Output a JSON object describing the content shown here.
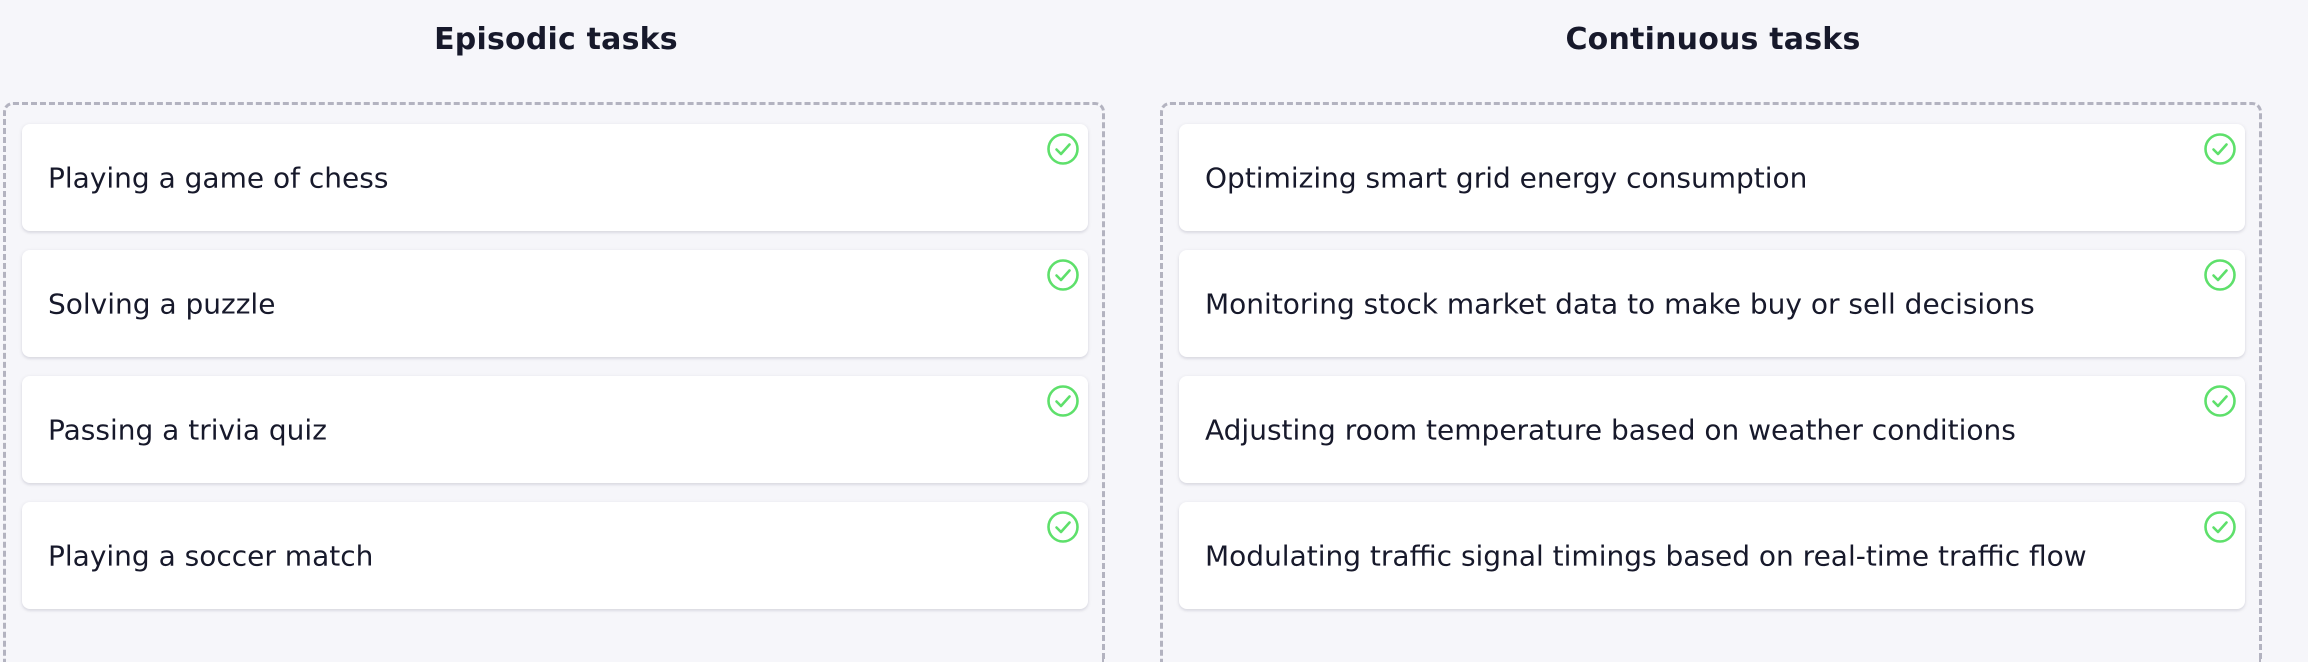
{
  "columns": [
    {
      "title": "Episodic tasks",
      "cards": [
        {
          "label": "Playing a game of chess",
          "status_icon": "check-circle-icon"
        },
        {
          "label": "Solving a puzzle",
          "status_icon": "check-circle-icon"
        },
        {
          "label": "Passing a trivia quiz",
          "status_icon": "check-circle-icon"
        },
        {
          "label": "Playing a soccer match",
          "status_icon": "check-circle-icon"
        }
      ]
    },
    {
      "title": "Continuous tasks",
      "cards": [
        {
          "label": "Optimizing smart grid energy consumption",
          "status_icon": "check-circle-icon"
        },
        {
          "label": "Monitoring stock market data to make buy or sell decisions",
          "status_icon": "check-circle-icon"
        },
        {
          "label": "Adjusting room temperature based on weather conditions",
          "status_icon": "check-circle-icon"
        },
        {
          "label": "Modulating traffic signal timings based on real-time traffic flow",
          "status_icon": "check-circle-icon"
        }
      ]
    }
  ],
  "colors": {
    "background": "#f6f6fa",
    "text": "#17192b",
    "card": "#ffffff",
    "dashed_border": "#b3b3c0",
    "correct_check": "#5ee06b"
  }
}
